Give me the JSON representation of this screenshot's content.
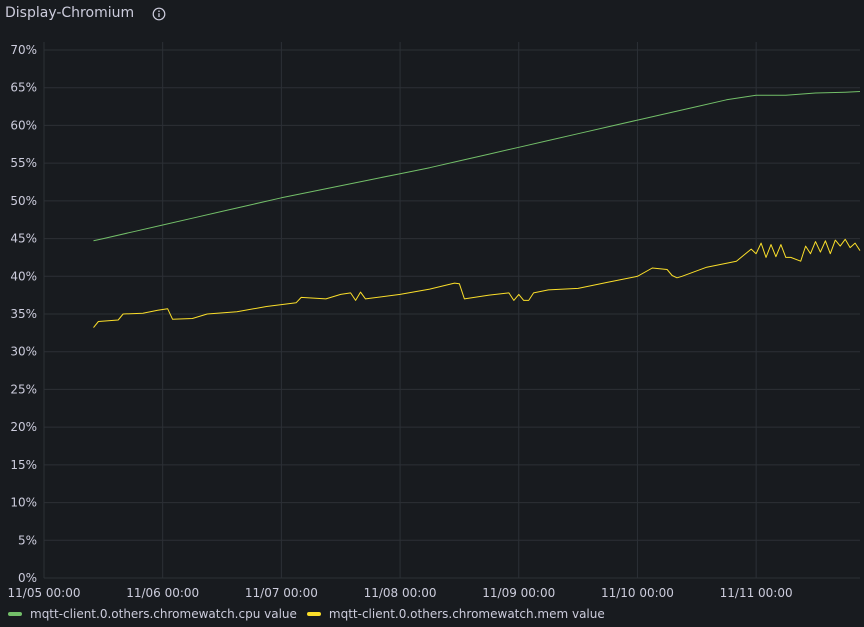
{
  "panel": {
    "title": "Display-Chromium"
  },
  "icons": {
    "info": "info-circle-icon"
  },
  "chart_data": {
    "type": "line",
    "xlabel": "",
    "ylabel": "",
    "ylim": [
      0,
      70
    ],
    "y_unit": "%",
    "y_ticks": [
      0,
      5,
      10,
      15,
      20,
      25,
      30,
      35,
      40,
      45,
      50,
      55,
      60,
      65,
      70
    ],
    "y_tick_labels": [
      "0%",
      "5%",
      "10%",
      "15%",
      "20%",
      "25%",
      "30%",
      "35%",
      "40%",
      "45%",
      "50%",
      "55%",
      "60%",
      "65%",
      "70%"
    ],
    "xlim": [
      "11/05 00:00",
      "11/11 21:00"
    ],
    "x_ticks": [
      "11/05 00:00",
      "11/06 00:00",
      "11/07 00:00",
      "11/08 00:00",
      "11/09 00:00",
      "11/10 00:00",
      "11/11 00:00"
    ],
    "grid": true,
    "legend": "bottom-left",
    "series": [
      {
        "name": "mqtt-client.0.others.chromewatch.cpu value",
        "color": "#73bf69",
        "x": [
          "11/05 10:00",
          "11/05 12:00",
          "11/05 18:00",
          "11/06 00:00",
          "11/06 06:00",
          "11/06 12:00",
          "11/06 18:00",
          "11/07 00:00",
          "11/07 06:00",
          "11/07 12:00",
          "11/07 18:00",
          "11/08 00:00",
          "11/08 06:00",
          "11/08 12:00",
          "11/08 18:00",
          "11/09 00:00",
          "11/09 06:00",
          "11/09 12:00",
          "11/09 18:00",
          "11/10 00:00",
          "11/10 06:00",
          "11/10 12:00",
          "11/10 18:00",
          "11/11 00:00",
          "11/11 06:00",
          "11/11 12:00",
          "11/11 18:00",
          "11/11 21:00"
        ],
        "values": [
          44.7,
          45.0,
          45.9,
          46.8,
          47.7,
          48.6,
          49.5,
          50.4,
          51.2,
          52.0,
          52.8,
          53.6,
          54.4,
          55.3,
          56.2,
          57.1,
          58.0,
          58.9,
          59.8,
          60.7,
          61.6,
          62.5,
          63.4,
          64.0,
          64.0,
          64.3,
          64.4,
          64.5
        ]
      },
      {
        "name": "mqtt-client.0.others.chromewatch.mem value",
        "color": "#fade2a",
        "x": [
          "11/05 10:00",
          "11/05 11:00",
          "11/05 15:00",
          "11/05 16:00",
          "11/05 20:00",
          "11/05 23:00",
          "11/06 01:00",
          "11/06 02:00",
          "11/06 06:00",
          "11/06 09:00",
          "11/06 15:00",
          "11/06 21:00",
          "11/07 03:00",
          "11/07 04:00",
          "11/07 09:00",
          "11/07 12:00",
          "11/07 14:00",
          "11/07 15:00",
          "11/07 16:00",
          "11/07 17:00",
          "11/08 00:00",
          "11/08 06:00",
          "11/08 11:00",
          "11/08 12:00",
          "11/08 13:00",
          "11/08 18:00",
          "11/08 22:00",
          "11/08 23:00",
          "11/09 00:00",
          "11/09 01:00",
          "11/09 02:00",
          "11/09 03:00",
          "11/09 06:00",
          "11/09 12:00",
          "11/09 18:00",
          "11/10 00:00",
          "11/10 03:00",
          "11/10 06:00",
          "11/10 07:00",
          "11/10 08:00",
          "11/10 09:00",
          "11/10 14:00",
          "11/10 20:00",
          "11/10 23:00",
          "11/11 00:00",
          "11/11 01:00",
          "11/11 02:00",
          "11/11 03:00",
          "11/11 04:00",
          "11/11 05:00",
          "11/11 06:00",
          "11/11 07:00",
          "11/11 09:00",
          "11/11 10:00",
          "11/11 11:00",
          "11/11 12:00",
          "11/11 13:00",
          "11/11 14:00",
          "11/11 15:00",
          "11/11 16:00",
          "11/11 17:00",
          "11/11 18:00",
          "11/11 19:00",
          "11/11 20:00",
          "11/11 21:00"
        ],
        "values": [
          33.2,
          34.0,
          34.2,
          35.0,
          35.1,
          35.5,
          35.7,
          34.3,
          34.4,
          35.0,
          35.3,
          36.0,
          36.5,
          37.2,
          37.0,
          37.6,
          37.8,
          36.8,
          37.9,
          37.0,
          37.6,
          38.3,
          39.1,
          39.0,
          37.0,
          37.5,
          37.8,
          36.8,
          37.6,
          36.8,
          36.8,
          37.8,
          38.2,
          38.4,
          39.2,
          40.0,
          41.1,
          40.9,
          40.1,
          39.8,
          40.0,
          41.2,
          42.0,
          43.6,
          43.0,
          44.4,
          42.5,
          44.2,
          42.6,
          44.2,
          42.5,
          42.5,
          42.0,
          44.0,
          43.0,
          44.6,
          43.2,
          44.7,
          43.0,
          44.8,
          44.0,
          44.9,
          43.8,
          44.4,
          43.4
        ]
      }
    ]
  }
}
